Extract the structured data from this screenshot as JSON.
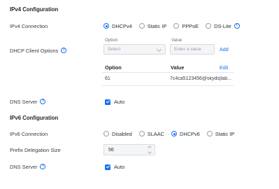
{
  "ipv4": {
    "section_title": "IPv4 Configuration",
    "connection": {
      "label": "IPv4 Connection",
      "options": [
        "DHCPv4",
        "Static IP",
        "PPPoE",
        "DS-Lite"
      ],
      "selected": "DHCPv4"
    },
    "dhcp_options": {
      "label": "DHCP Client Options",
      "option_caption": "Option",
      "value_caption": "Value",
      "select_placeholder": "Select",
      "value_placeholder": "Enter a value",
      "add_label": "Add",
      "table": {
        "headers": [
          "Option",
          "Value"
        ],
        "edit_label": "Edit",
        "rows": [
          {
            "option": "61",
            "value": "7c4ca5123456@skyds|lab..."
          }
        ]
      }
    },
    "dns": {
      "label": "DNS Server",
      "checkbox_label": "Auto",
      "checked": true
    }
  },
  "ipv6": {
    "section_title": "IPv6 Configuration",
    "connection": {
      "label": "IPv6 Connection",
      "options": [
        "Disabled",
        "SLAAC",
        "DHCPv6",
        "Static IP"
      ],
      "selected": "DHCPv6"
    },
    "prefix": {
      "label": "Prefix Delegation Size",
      "value": "56"
    },
    "dns": {
      "label": "DNS Server",
      "checkbox_label": "Auto",
      "checked": true
    }
  },
  "colors": {
    "accent": "#1570ef"
  }
}
